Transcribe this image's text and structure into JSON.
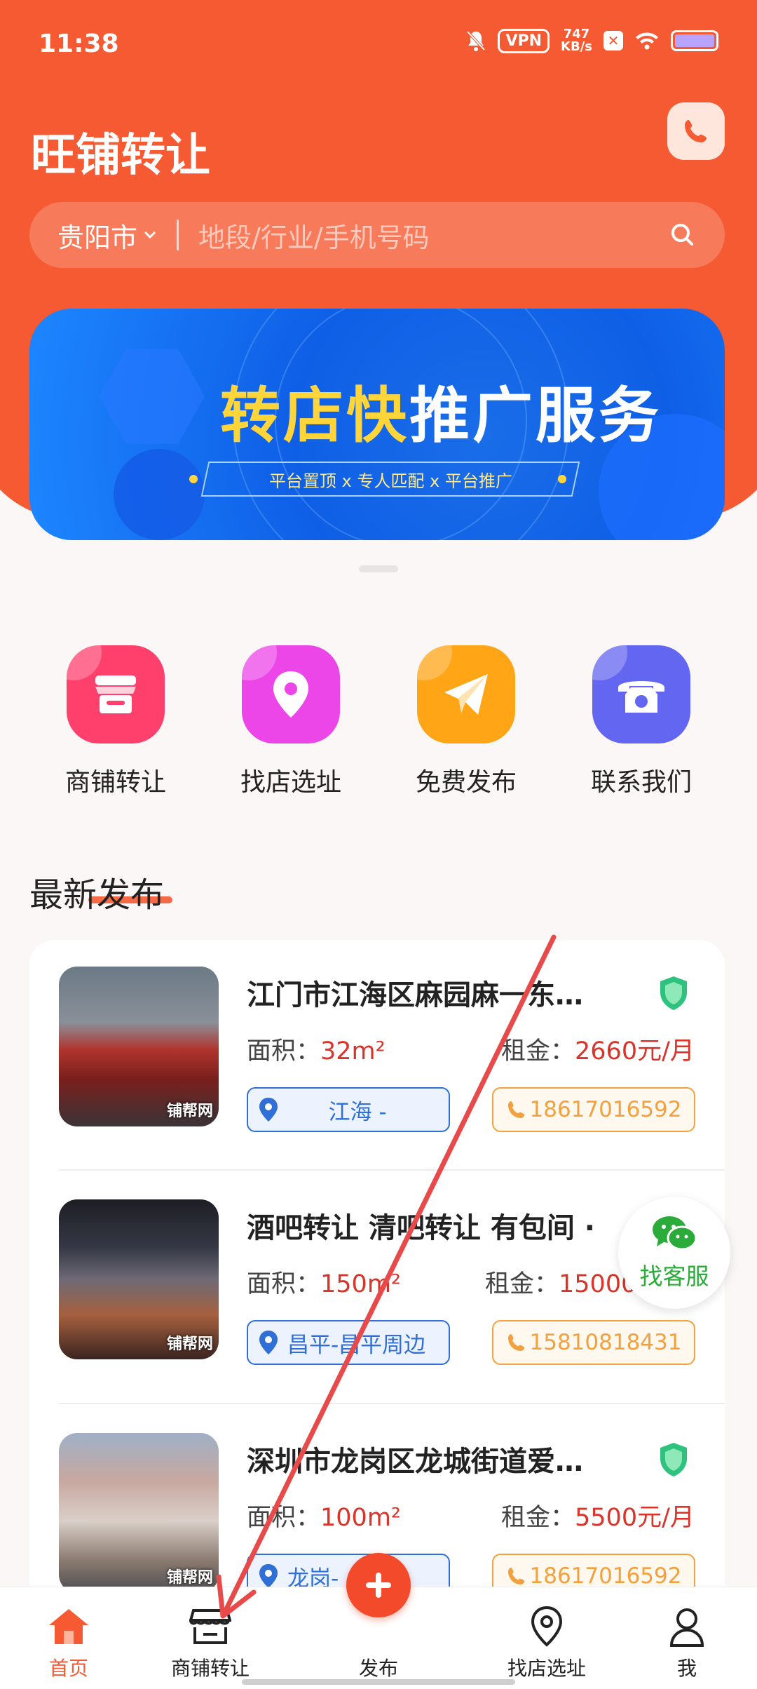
{
  "status_bar": {
    "time": "11:38",
    "vpn": "VPN",
    "speed_value": "747",
    "speed_unit": "KB/s"
  },
  "header": {
    "app_title": "旺铺转让",
    "city": "贵阳市",
    "search_placeholder": "地段/行业/手机号码"
  },
  "banner": {
    "headline_part1": "转店快",
    "headline_part2": "推广服务",
    "tagline": "平台置顶 x 专人匹配 x 平台推广"
  },
  "quick_menu": [
    {
      "label": "商铺转让",
      "icon": "store-icon",
      "color": "#ff3f6c"
    },
    {
      "label": "找店选址",
      "icon": "location-pin-icon",
      "color": "#ec45e8"
    },
    {
      "label": "免费发布",
      "icon": "paper-plane-icon",
      "color": "#ffa516"
    },
    {
      "label": "联系我们",
      "icon": "telephone-icon",
      "color": "#6366f1"
    }
  ],
  "latest": {
    "section_title": "最新发布",
    "area_label": "面积：",
    "rent_label": "租金：",
    "watermark": "铺帮网",
    "items": [
      {
        "title": "江门市江海区麻园麻一东…",
        "area": "32m²",
        "rent": "2660元/月",
        "location": "江海 -",
        "phone": "18617016592",
        "verified": true
      },
      {
        "title": "酒吧转让 清吧转让 有包间 ·",
        "area": "150m²",
        "rent": "15000",
        "location": "昌平-昌平周边",
        "phone": "15810818431",
        "verified": false
      },
      {
        "title": "深圳市龙岗区龙城街道爱…",
        "area": "100m²",
        "rent": "5500元/月",
        "location": "龙岗-",
        "phone": "18617016592",
        "verified": true
      }
    ]
  },
  "float_service": {
    "label": "找客服"
  },
  "bottom_nav": {
    "home": "首页",
    "shops": "商铺转让",
    "publish": "发布",
    "find": "找店选址",
    "me": "我"
  },
  "colors": {
    "brand": "#f55a32",
    "price": "#d9342a",
    "location_tag": "#2f6fd6",
    "phone_tag": "#f3a13e",
    "verified": "#2ec27e"
  }
}
